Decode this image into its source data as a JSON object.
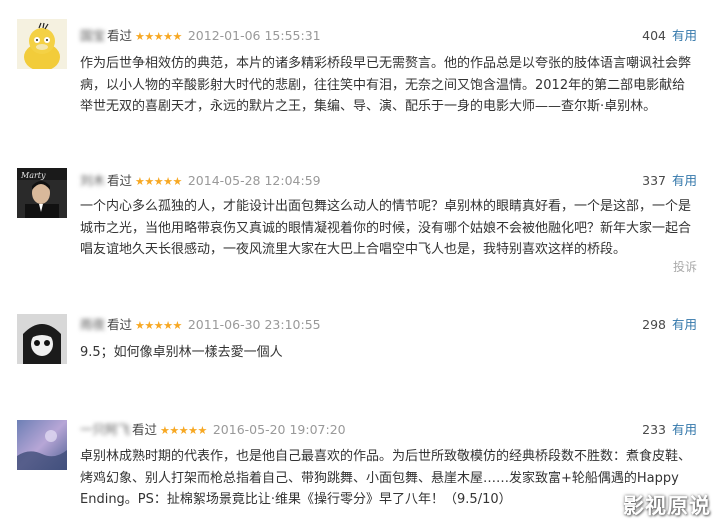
{
  "reviews": [
    {
      "username": "国宝",
      "action": "看过",
      "stars": "★★★★★",
      "time": "2012-01-06 15:55:31",
      "votes": "404",
      "useful_label": "有用",
      "content": "作为后世争相效仿的典范，本片的诸多精彩桥段早已无需赘言。他的作品总是以夸张的肢体语言嘲讽社会弊病，以小人物的辛酸影射大时代的悲剧，往往笑中有泪，无奈之间又饱含温情。2012年的第二部电影献给举世无双的喜剧天才，永远的默片之王，集编、导、演、配乐于一身的电影大师——查尔斯·卓别林。"
    },
    {
      "username": "刘木",
      "action": "看过",
      "stars": "★★★★★",
      "time": "2014-05-28 12:04:59",
      "votes": "337",
      "useful_label": "有用",
      "content": "一个内心多么孤独的人，才能设计出面包舞这么动人的情节呢？卓别林的眼睛真好看，一个是这部，一个是城市之光，当他用略带哀伤又真诚的眼情凝视着你的时候，没有哪个姑娘不会被他融化吧？新年大家一起合唱友谊地久天长很感动，一夜风流里大家在大巴上合唱空中飞人也是，我特别喜欢这样的桥段。",
      "report_label": "投诉"
    },
    {
      "username": "雨夜",
      "action": "看过",
      "stars": "★★★★★",
      "time": "2011-06-30 23:10:55",
      "votes": "298",
      "useful_label": "有用",
      "content": "9.5；如何像卓别林一樣去愛一個人"
    },
    {
      "username": "一只阿飞",
      "action": "看过",
      "stars": "★★★★★",
      "time": "2016-05-20 19:07:20",
      "votes": "233",
      "useful_label": "有用",
      "content": "卓别林成熟时期的代表作，也是他自己最喜欢的作品。为后世所致敬模仿的经典桥段数不胜数：煮食皮鞋、烤鸡幻象、别人打架而枪总指着自己、带狗跳舞、小面包舞、悬崖木屋……发家致富+轮船偶遇的Happy Ending。PS：扯棉絮场景竟比让·维果《操行零分》早了八年！（9.5/10）"
    }
  ],
  "watermark": "影视原说",
  "colors": {
    "star": "#f7a823",
    "useful_link": "#3377aa",
    "time": "#999999",
    "report": "#aaaaaa"
  }
}
